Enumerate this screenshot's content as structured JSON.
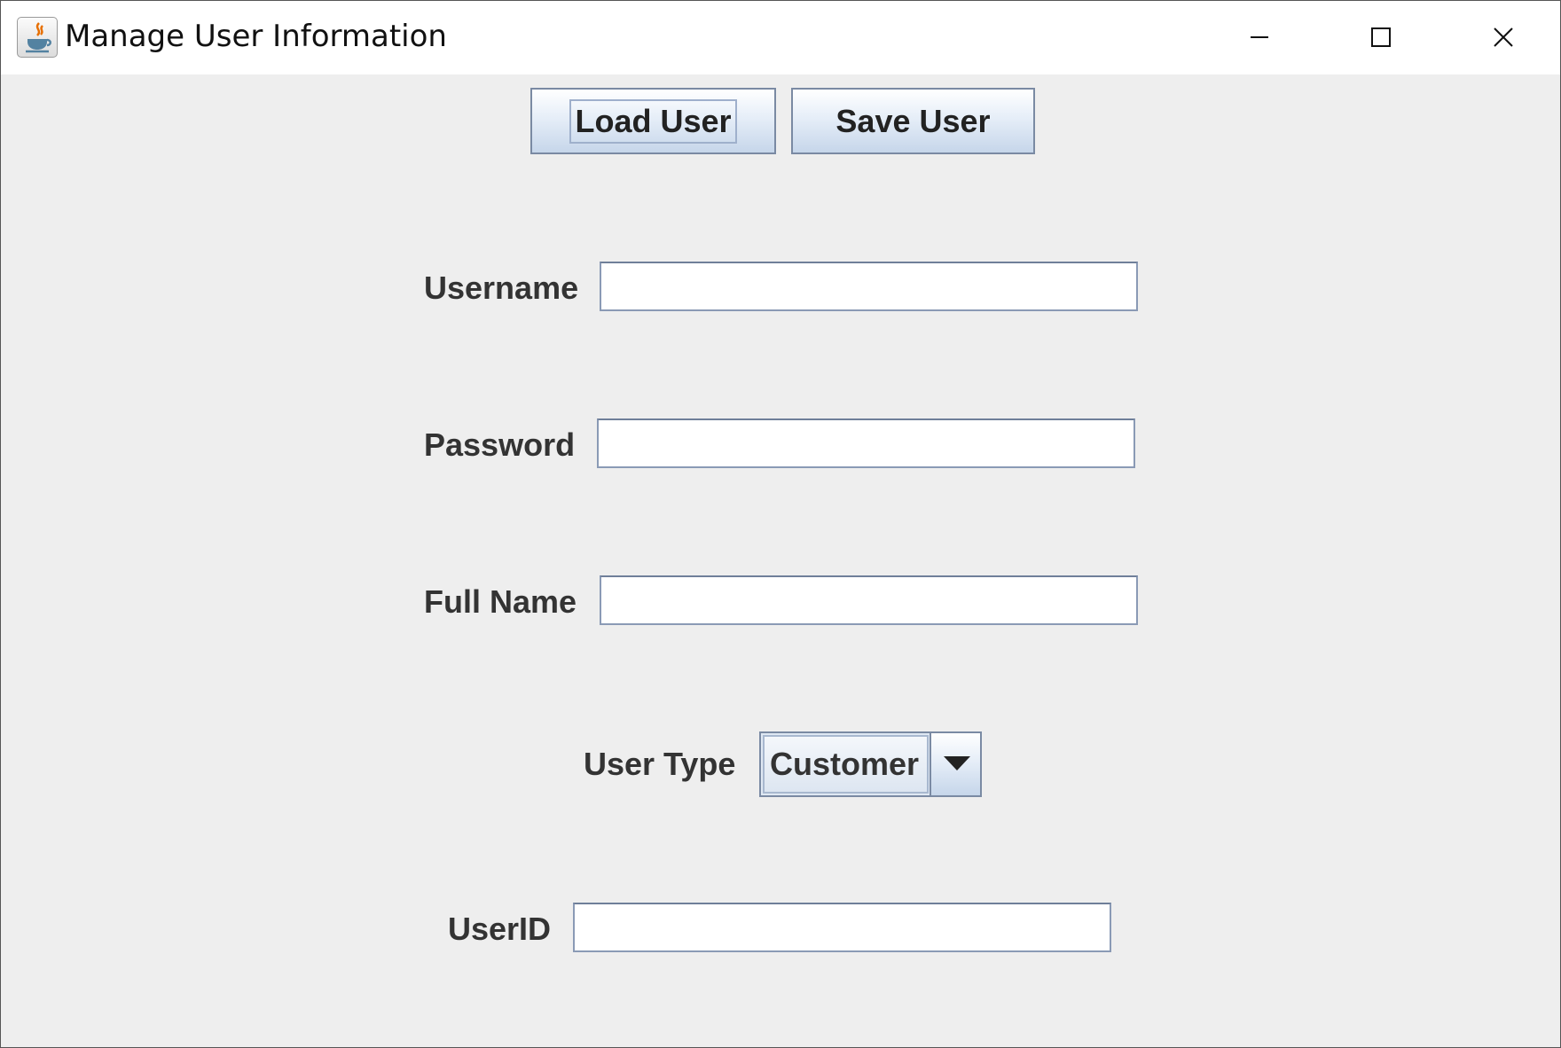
{
  "window": {
    "title": "Manage User Information",
    "icon": "java-icon",
    "controls": {
      "minimize_icon": "minimize-icon",
      "maximize_icon": "maximize-icon",
      "close_icon": "close-icon"
    }
  },
  "toolbar": {
    "load_label": "Load User",
    "save_label": "Save User"
  },
  "form": {
    "username": {
      "label": "Username",
      "value": ""
    },
    "password": {
      "label": "Password",
      "value": ""
    },
    "full_name": {
      "label": "Full Name",
      "value": ""
    },
    "user_type": {
      "label": "User Type",
      "selected": "Customer"
    },
    "user_id": {
      "label": "UserID",
      "value": ""
    }
  },
  "colors": {
    "window_background": "#eeeeee",
    "titlebar_background": "#ffffff",
    "button_border": "#7a8aa3",
    "text": "#333333"
  }
}
